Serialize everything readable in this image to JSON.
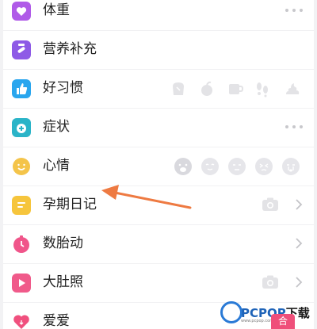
{
  "colors": {
    "weight": "#b05be8",
    "supplement": "#8e5ae6",
    "habit": "#2aa6ee",
    "symptom": "#2bb4c8",
    "mood": "#f4c44a",
    "diary": "#f6c53c",
    "kicks": "#f0558a",
    "belly": "#f05a8a",
    "love": "#f0507e",
    "arrow": "#ee7a42",
    "watermark_blue": "#1e63b8"
  },
  "rows": [
    {
      "label": "体重",
      "icon": "heart-badge-icon",
      "trailing": "more-dots"
    },
    {
      "label": "营养补充",
      "icon": "pill-bag-icon",
      "trailing": "none"
    },
    {
      "label": "好习惯",
      "icon": "thumbs-up-icon",
      "trailing": "habit-icons"
    },
    {
      "label": "症状",
      "icon": "medical-kit-icon",
      "trailing": "more-dots"
    },
    {
      "label": "心情",
      "icon": "smile-face-icon",
      "trailing": "mood-faces"
    },
    {
      "label": "孕期日记",
      "icon": "diary-icon",
      "trailing": "camera-chevron"
    },
    {
      "label": "数胎动",
      "icon": "stopwatch-icon",
      "trailing": "chevron"
    },
    {
      "label": "大肚照",
      "icon": "play-icon",
      "trailing": "camera-chevron"
    },
    {
      "label": "爱爱",
      "icon": "heart-icon",
      "trailing": "none"
    }
  ],
  "watermark": {
    "brand": "PCPOP",
    "suffix": "下载",
    "sub": "www.pcpop.com"
  },
  "pink_button": "合"
}
